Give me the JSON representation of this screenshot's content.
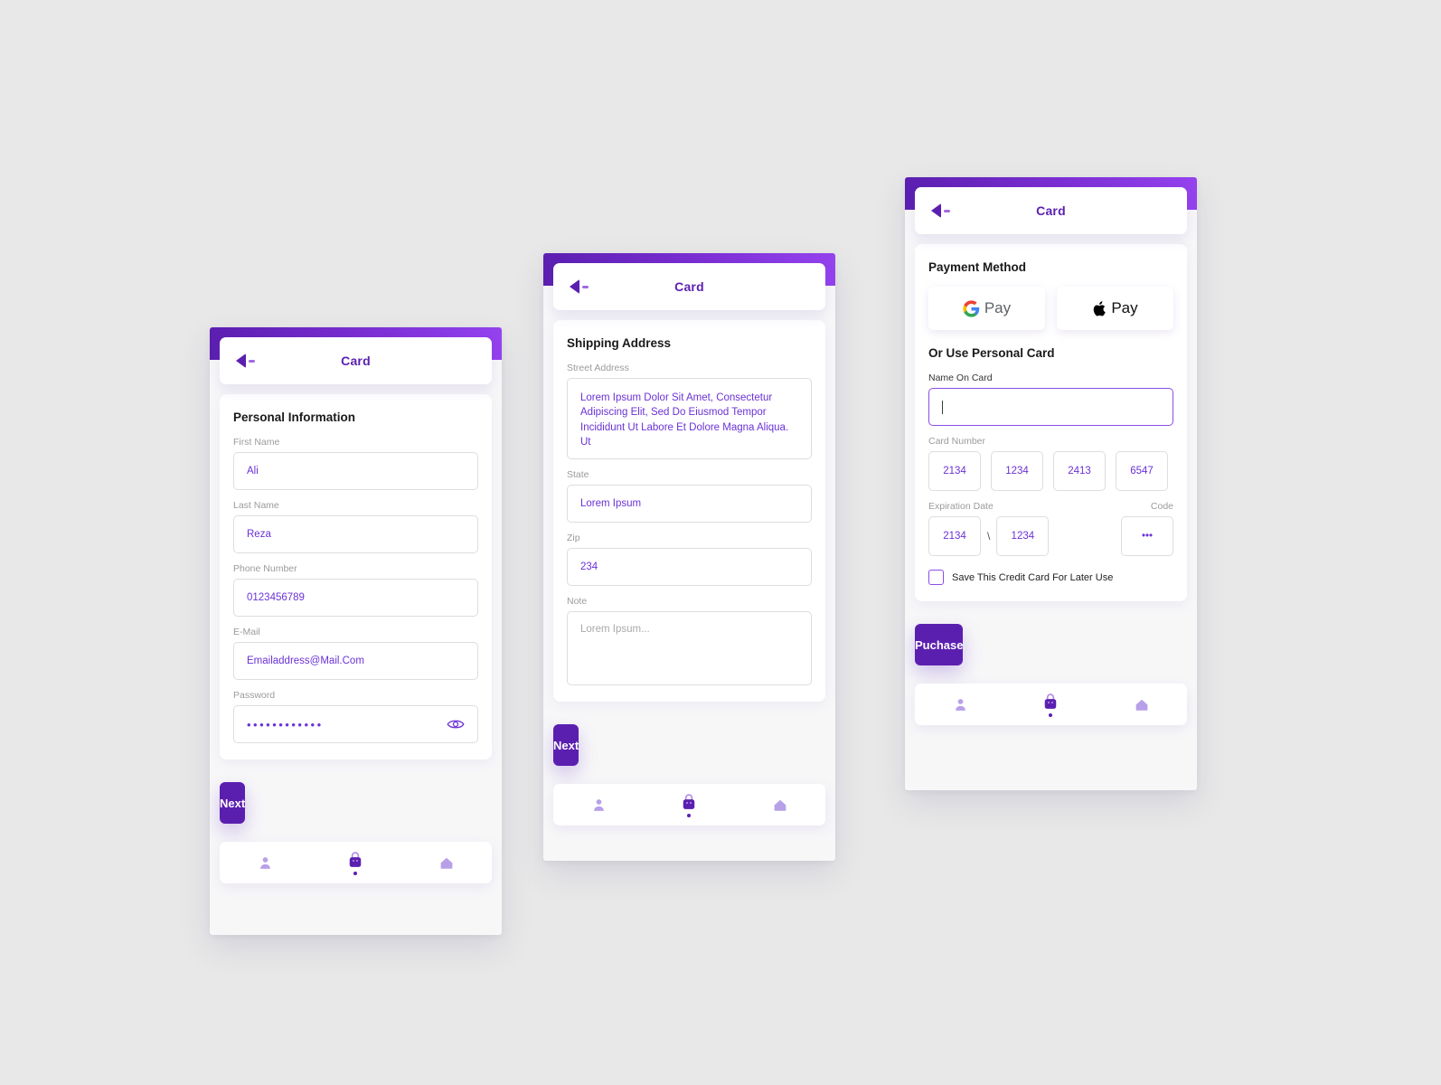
{
  "theme": {
    "primary": "#5B1FB0",
    "primary_light": "#9442EE",
    "input_text": "#6B32D6",
    "label_gray": "#9b9b9b",
    "background": "#e8e8e8"
  },
  "screens": [
    {
      "id": "personal-information",
      "header": {
        "title": "Card",
        "back_icon": "back-arrow-icon"
      },
      "section_title": "Personal Information",
      "fields": [
        {
          "label": "First Name",
          "value": "Ali"
        },
        {
          "label": "Last Name",
          "value": "Reza"
        },
        {
          "label": "Phone Number",
          "value": "0123456789"
        },
        {
          "label": "E-Mail",
          "value": "Emailaddress@Mail.Com"
        },
        {
          "label": "Password",
          "value": "••••••••••••",
          "toggle_icon": "eye-icon"
        }
      ],
      "cta": "Next",
      "nav": [
        {
          "icon": "person-icon",
          "active": false
        },
        {
          "icon": "shopping-bag-icon",
          "active": true
        },
        {
          "icon": "home-icon",
          "active": false
        }
      ]
    },
    {
      "id": "shipping-address",
      "header": {
        "title": "Card",
        "back_icon": "back-arrow-icon"
      },
      "section_title": "Shipping Address",
      "fields": [
        {
          "label": "Street Address",
          "value": "Lorem Ipsum Dolor Sit Amet, Consectetur Adipiscing Elit, Sed Do Eiusmod Tempor Incididunt Ut Labore Et Dolore Magna Aliqua. Ut"
        },
        {
          "label": "State",
          "value": "Lorem Ipsum"
        },
        {
          "label": "Zip",
          "value": "234"
        },
        {
          "label": "Note",
          "placeholder": "Lorem Ipsum..."
        }
      ],
      "cta": "Next",
      "nav": [
        {
          "icon": "person-icon",
          "active": false
        },
        {
          "icon": "shopping-bag-icon",
          "active": true
        },
        {
          "icon": "home-icon",
          "active": false
        }
      ]
    },
    {
      "id": "payment",
      "header": {
        "title": "Card",
        "back_icon": "back-arrow-icon"
      },
      "payment_method_title": "Payment Method",
      "payment_buttons": [
        {
          "icon": "google-logo-icon",
          "label": "Pay"
        },
        {
          "icon": "apple-logo-icon",
          "label": "Pay"
        }
      ],
      "personal_card_title": "Or Use Personal Card",
      "name_on_card": {
        "label": "Name On Card",
        "value": "",
        "focused": true
      },
      "card_number": {
        "label": "Card Number",
        "groups": [
          "2134",
          "1234",
          "2413",
          "6547"
        ]
      },
      "expiration": {
        "label": "Expiration Date",
        "month": "2134",
        "separator": "\\",
        "year": "1234"
      },
      "code": {
        "label": "Code",
        "value": "•••"
      },
      "save_card": {
        "label": "Save This Credit Card For Later Use",
        "checked": false
      },
      "cta": "Puchase",
      "nav": [
        {
          "icon": "person-icon",
          "active": false
        },
        {
          "icon": "shopping-bag-icon",
          "active": true
        },
        {
          "icon": "home-icon",
          "active": false
        }
      ]
    }
  ]
}
